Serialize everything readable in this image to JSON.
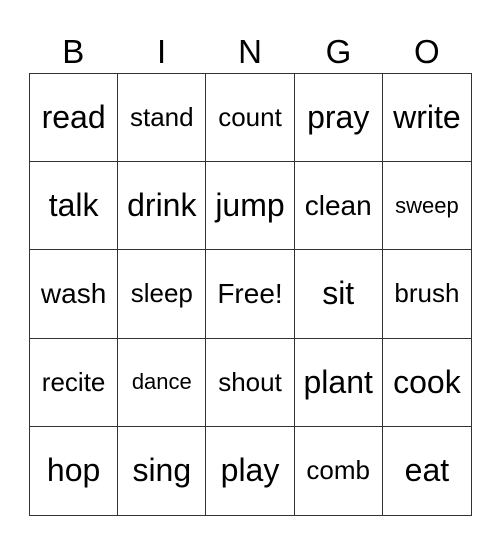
{
  "header": [
    "B",
    "I",
    "N",
    "G",
    "O"
  ],
  "cells": [
    "read",
    "stand",
    "count",
    "pray",
    "write",
    "talk",
    "drink",
    "jump",
    "clean",
    "sweep",
    "wash",
    "sleep",
    "Free!",
    "sit",
    "brush",
    "recite",
    "dance",
    "shout",
    "plant",
    "cook",
    "hop",
    "sing",
    "play",
    "comb",
    "eat"
  ]
}
